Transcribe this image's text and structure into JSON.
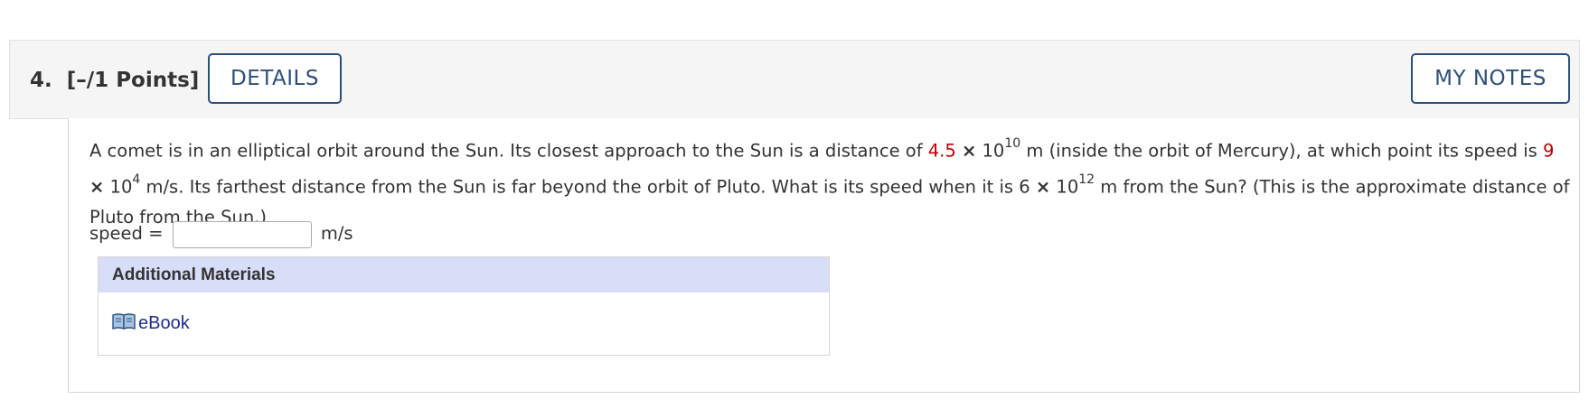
{
  "header": {
    "question_number": "4.",
    "points": "[–/1 Points]",
    "details_label": "DETAILS",
    "my_notes_label": "MY NOTES"
  },
  "question": {
    "text_1": "A comet is in an elliptical orbit around the Sun. Its closest approach to the Sun is a distance of ",
    "value_1": "4.5",
    "times": "×",
    "base_1": " 10",
    "exp_1": "10",
    "text_2": " m (inside the orbit of Mercury), at which point its speed is ",
    "value_2": "9",
    "base_2": " 10",
    "exp_2": "4",
    "text_3": " m/s. Its farthest distance from the Sun is far beyond the orbit of Pluto. What is its speed when it is 6 ",
    "base_3": " 10",
    "exp_3": "12",
    "text_4": " m from the Sun? (This is the approximate distance of Pluto from the Sun.)",
    "value_color": "#c00000"
  },
  "answer": {
    "label": "speed =",
    "value": "",
    "unit": "m/s"
  },
  "additional_materials": {
    "title": "Additional Materials",
    "ebook_label": "eBook",
    "ebook_icon": "book-icon",
    "header_color": "#d9def8",
    "link_color": "#1f2f8a"
  },
  "accent_color": "#2b4f7c"
}
